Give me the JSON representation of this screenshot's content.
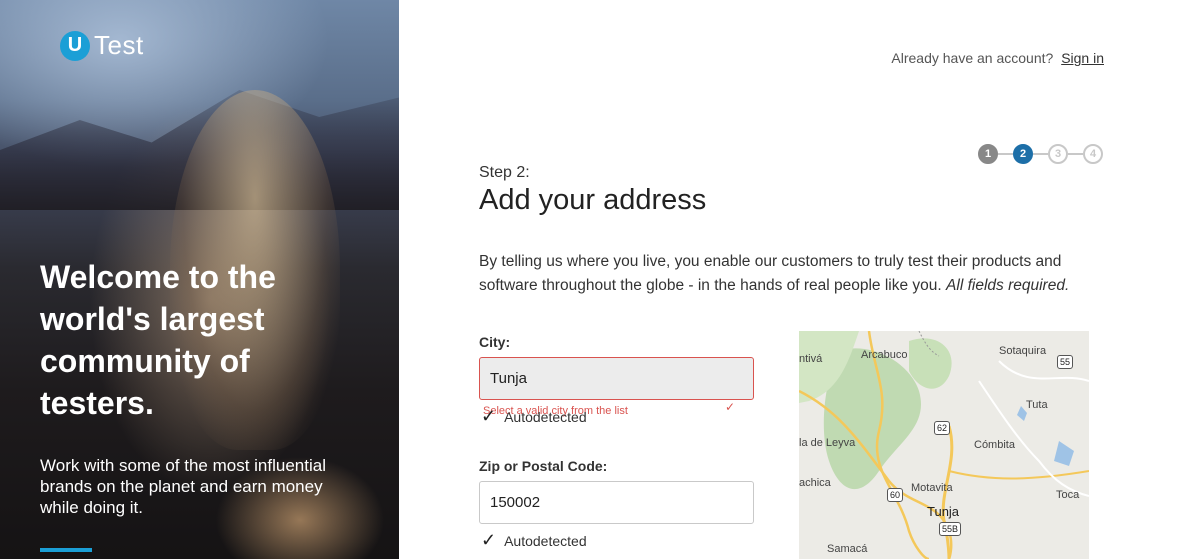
{
  "brand": {
    "logo_letter": "U",
    "logo_text": "Test"
  },
  "hero": {
    "title": "Welcome to the world's largest community of testers.",
    "subtitle": "Work with some of the most influential brands on the planet and earn money while doing it."
  },
  "header": {
    "account_prompt": "Already have an account?",
    "sign_in_label": "Sign in"
  },
  "stepper": {
    "steps": [
      "1",
      "2",
      "3",
      "4"
    ],
    "current": 2
  },
  "form": {
    "step_label": "Step 2:",
    "title": "Add your address",
    "intro": "By telling us where you live, you enable our customers to truly test their products and software throughout the globe - in the hands of real people like you.",
    "intro_required": "All fields required.",
    "city": {
      "label": "City:",
      "value": "Tunja",
      "error": "Select a valid city from the list",
      "autodetected": "Autodetected"
    },
    "zip": {
      "label": "Zip or Postal Code:",
      "value": "150002",
      "autodetected": "Autodetected"
    }
  },
  "map": {
    "places": {
      "antiva": "ntivá",
      "arcabuco": "Arcabuco",
      "sotaquira": "Sotaquira",
      "tuta": "Tuta",
      "leyva": "la de Leyva",
      "combita": "Cómbita",
      "chica": "achica",
      "motavita": "Motavita",
      "toca": "Toca",
      "tunja": "Tunja",
      "samaca": "Samacá"
    },
    "routes": {
      "r55": "55",
      "r62": "62",
      "r60": "60",
      "r55b": "55B"
    },
    "colors": {
      "land": "#ecebe6",
      "forest": "#b9d7a8",
      "road": "#f4c85a",
      "water": "#9fc3e6"
    }
  },
  "colors": {
    "accent": "#1b9fd6",
    "step_active": "#1d6fa8",
    "error": "#d9534f"
  }
}
